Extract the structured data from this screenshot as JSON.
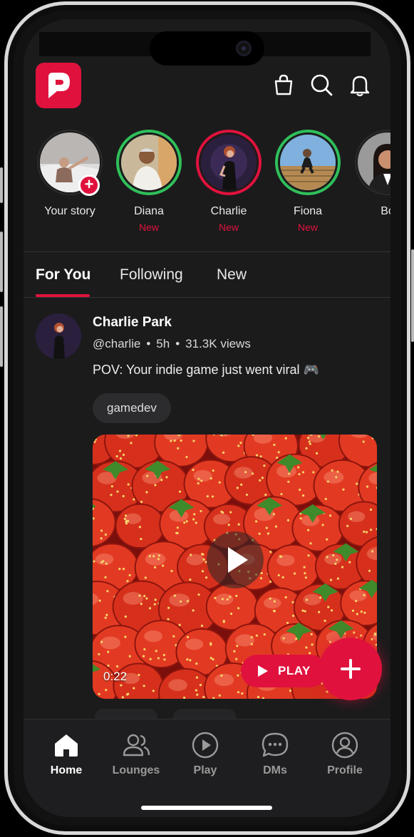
{
  "colors": {
    "accent": "#e0123d",
    "background": "#1b1b1c",
    "story_green": "#2fc05a",
    "story_red": "#e0123d"
  },
  "header": {
    "icons": [
      "bag-icon",
      "search-icon",
      "bell-icon"
    ]
  },
  "stories": [
    {
      "name": "Your story",
      "badge": "",
      "ring": "none"
    },
    {
      "name": "Diana",
      "badge": "New",
      "ring": "green"
    },
    {
      "name": "Charlie",
      "badge": "New",
      "ring": "red"
    },
    {
      "name": "Fiona",
      "badge": "New",
      "ring": "green"
    },
    {
      "name": "Bo",
      "badge": "",
      "ring": "none"
    }
  ],
  "tabs": [
    {
      "label": "For You",
      "active": true
    },
    {
      "label": "Following",
      "active": false
    },
    {
      "label": "New",
      "active": false
    }
  ],
  "post": {
    "author": "Charlie Park",
    "handle": "@charlie",
    "age": "5h",
    "views": "31.3K views",
    "caption": "POV: Your indie game just went viral 🎮",
    "tag": "gamedev",
    "duration": "0:22",
    "play_label": "PLAY"
  },
  "nav": [
    {
      "label": "Home",
      "icon": "home-icon",
      "active": true
    },
    {
      "label": "Lounges",
      "icon": "people-icon",
      "active": false
    },
    {
      "label": "Play",
      "icon": "play-circle-icon",
      "active": false
    },
    {
      "label": "DMs",
      "icon": "chat-icon",
      "active": false
    },
    {
      "label": "Profile",
      "icon": "profile-icon",
      "active": false
    }
  ]
}
